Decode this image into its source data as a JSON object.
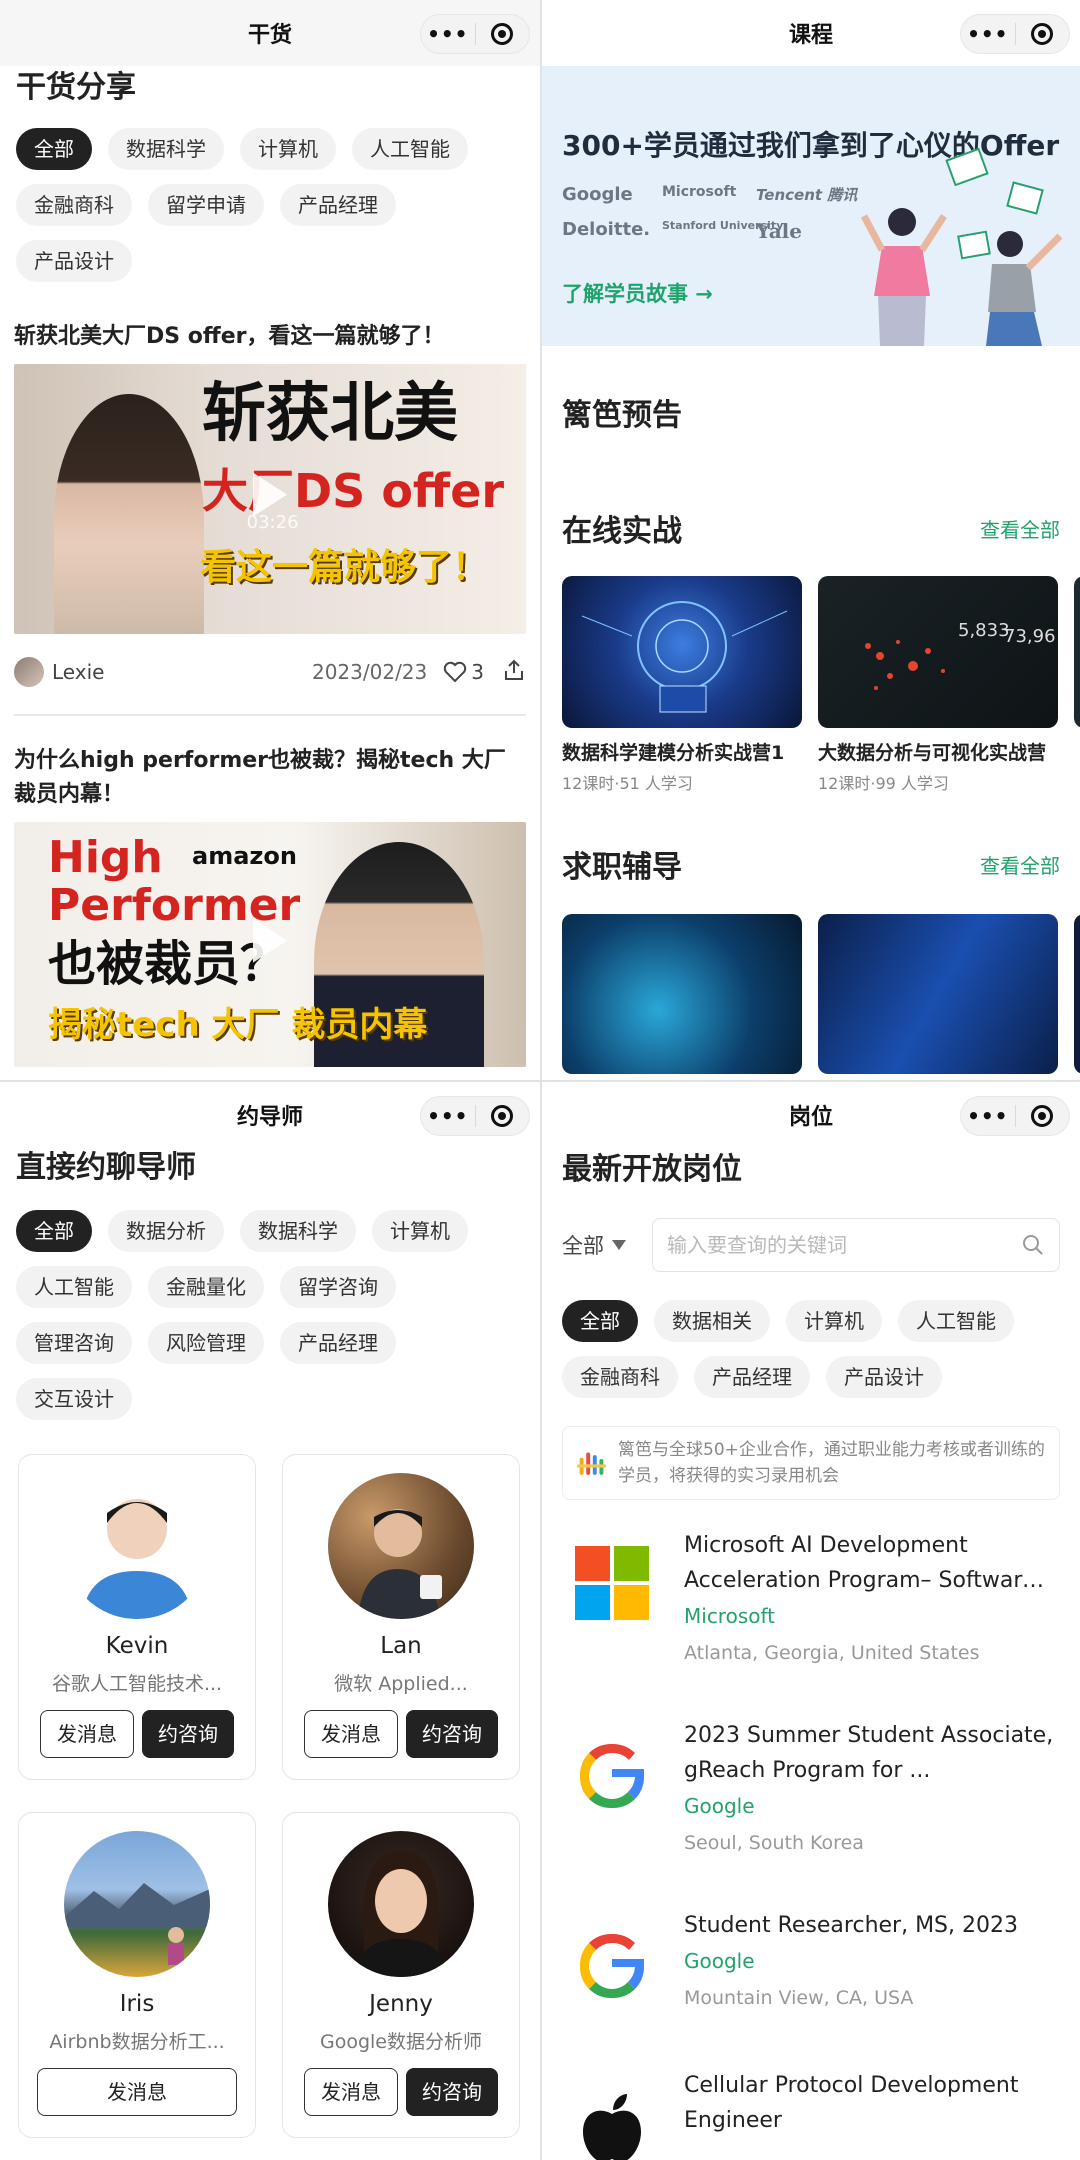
{
  "panel1": {
    "nav_title": "干货",
    "heading": "干货分享",
    "tags": [
      "全部",
      "数据科学",
      "计算机",
      "人工智能",
      "金融商科",
      "留学申请",
      "产品经理",
      "产品设计"
    ],
    "articles": [
      {
        "title": "斩获北美大厂DS offer，看这一篇就够了！",
        "thumb_line1": "斩获北美",
        "thumb_line2": "大厂DS offer",
        "thumb_line3": "看这一篇就够了！",
        "duration": "03:26",
        "author": "Lexie",
        "date": "2023/02/23",
        "likes": "3"
      },
      {
        "title": "为什么high performer也被裁？揭秘tech 大厂裁员内幕！",
        "thumb_line1": "High",
        "thumb_line2": "Performer",
        "thumb_brand": "amazon",
        "thumb_line3": "也被裁员？",
        "thumb_line4": "揭秘tech 大厂 裁员内幕"
      }
    ]
  },
  "panel2": {
    "nav_title": "课程",
    "banner": {
      "title": "300+学员通过我们拿到了心仪的Offer",
      "logos": [
        "Google",
        "Microsoft",
        "Tencent 腾讯",
        "Deloitte.",
        "Stanford University",
        "Yale"
      ],
      "link": "了解学员故事 →"
    },
    "section_preview": "篱笆预告",
    "section_online": {
      "title": "在线实战",
      "view_all": "查看全部",
      "courses": [
        {
          "title": "数据科学建模分析实战营1",
          "meta": "12课时·51 人学习"
        },
        {
          "title": "大数据分析与可视化实战营",
          "meta": "12课时·99 人学习"
        }
      ]
    },
    "section_career": {
      "title": "求职辅导",
      "view_all": "查看全部"
    }
  },
  "panel3": {
    "nav_title": "约导师",
    "heading": "直接约聊导师",
    "tags": [
      "全部",
      "数据分析",
      "数据科学",
      "计算机",
      "人工智能",
      "金融量化",
      "留学咨询",
      "管理咨询",
      "风险管理",
      "产品经理",
      "交互设计"
    ],
    "msg_label": "发消息",
    "book_label": "约咨询",
    "mentors": [
      {
        "name": "Kevin",
        "desc": "谷歌人工智能技术..."
      },
      {
        "name": "Lan",
        "desc": "微软 Applied..."
      },
      {
        "name": "Iris",
        "desc": "Airbnb数据分析工..."
      },
      {
        "name": "Jenny",
        "desc": "Google数据分析师"
      }
    ]
  },
  "panel4": {
    "nav_title": "岗位",
    "heading": "最新开放岗位",
    "filter_label": "全部",
    "search_placeholder": "输入要查询的关键词",
    "tags": [
      "全部",
      "数据相关",
      "计算机",
      "人工智能",
      "金融商科",
      "产品经理",
      "产品设计"
    ],
    "notice": "篱笆与全球50+企业合作，通过职业能力考核或者训练的学员，将获得的实习录用机会",
    "jobs": [
      {
        "title": "Microsoft AI Development Acceleration Program– Software Engineering",
        "company": "Microsoft",
        "location": "Atlanta, Georgia, United States"
      },
      {
        "title": "2023 Summer Student Associate, gReach Program for ...",
        "company": "Google",
        "location": "Seoul, South Korea"
      },
      {
        "title": "Student Researcher, MS, 2023",
        "company": "Google",
        "location": "Mountain View, CA, USA"
      },
      {
        "title": "Cellular Protocol Development Engineer",
        "company": "",
        "location": ""
      }
    ]
  },
  "colors": {
    "accent_green": "#23a26b",
    "dark": "#222222",
    "chip_bg": "#f2f2f2",
    "banner_bg": "#e6f0fb"
  }
}
